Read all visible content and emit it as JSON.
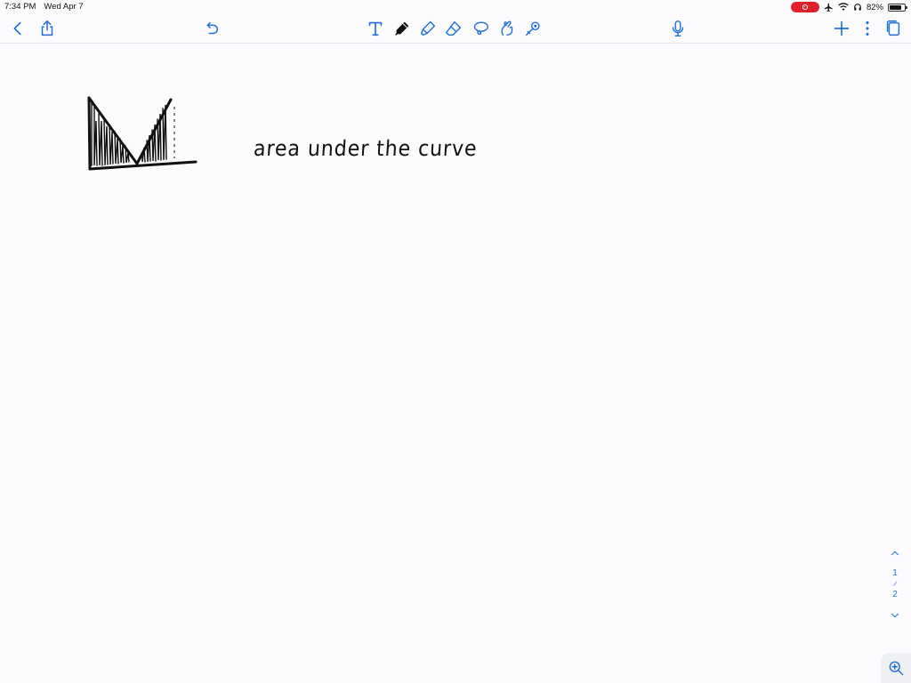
{
  "status_bar": {
    "time": "7:34 PM",
    "date": "Wed Apr 7",
    "battery": "82%",
    "battery_level": 0.82,
    "icons": [
      "screen-record-icon",
      "airplane-icon",
      "wifi-icon",
      "headphones-icon",
      "battery-icon"
    ]
  },
  "toolbar": {
    "left": [
      "back-icon",
      "share-icon",
      "undo-icon"
    ],
    "tools": [
      "text-tool-icon",
      "pen-icon",
      "highlighter-icon",
      "eraser-icon",
      "lasso-icon",
      "shapes-icon",
      "laser-pointer-icon"
    ],
    "right": [
      "microphone-icon",
      "add-icon",
      "more-icon",
      "pages-icon"
    ],
    "accent_color": "#1e6fd9"
  },
  "page": {
    "handwritten_note": "area under the curve",
    "ink_color": "#111111"
  },
  "pager": {
    "current": "1",
    "separator": "/",
    "total": "2"
  },
  "zoom": {
    "icon": "zoom-in-icon"
  }
}
